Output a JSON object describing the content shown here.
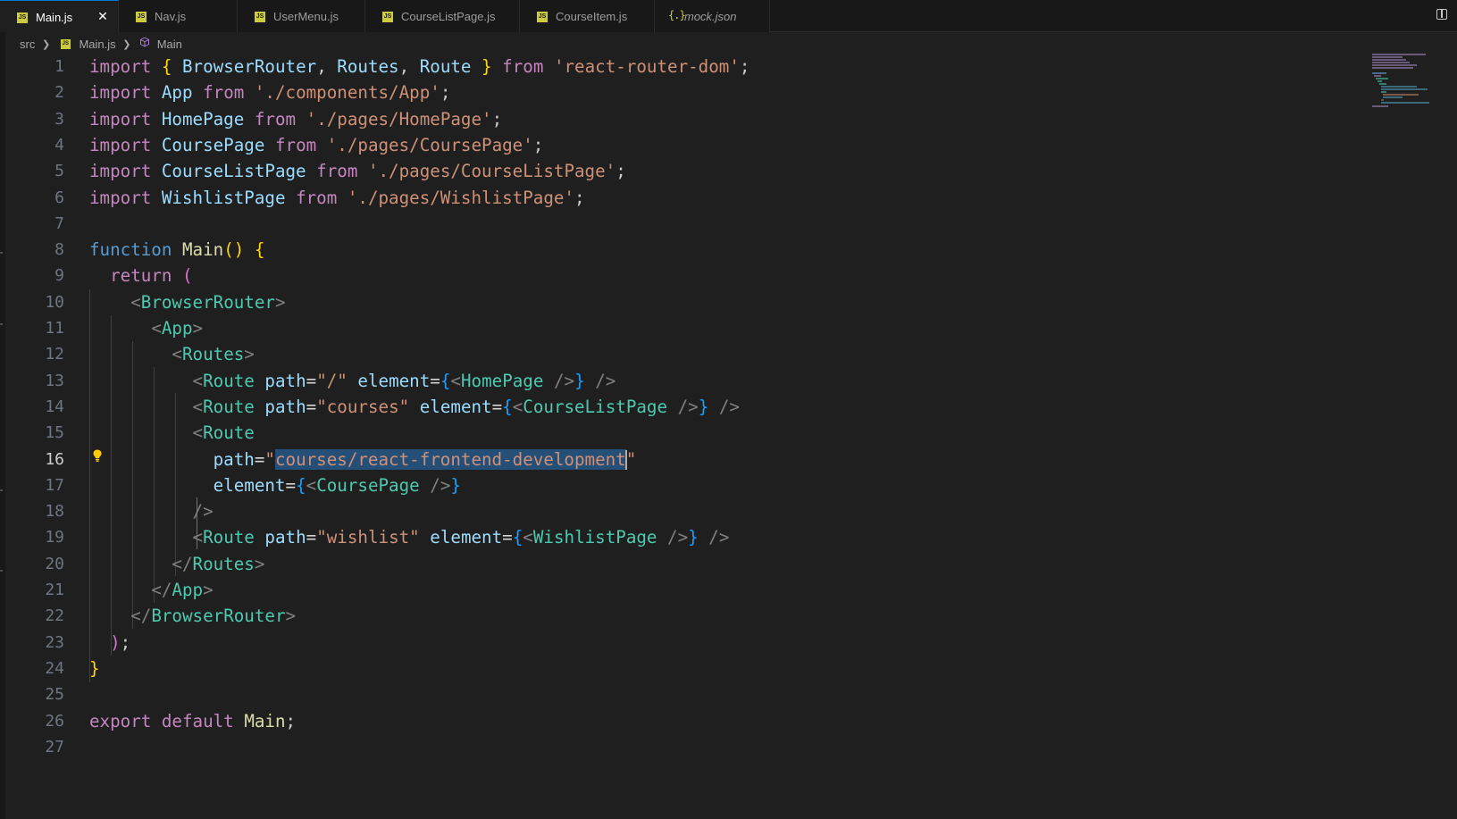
{
  "tabs": [
    {
      "label": "Main.js",
      "icon": "js-file-icon",
      "active": true
    },
    {
      "label": "Nav.js",
      "icon": "js-file-icon",
      "active": false
    },
    {
      "label": "UserMenu.js",
      "icon": "js-file-icon",
      "active": false
    },
    {
      "label": "CourseListPage.js",
      "icon": "js-file-icon",
      "active": false
    },
    {
      "label": "CourseItem.js",
      "icon": "js-file-icon",
      "active": false
    },
    {
      "label": "mock.json",
      "icon": "json-file-icon",
      "active": false
    }
  ],
  "breadcrumb": {
    "folder": "src",
    "file": "Main.js",
    "symbol": "Main"
  },
  "editor": {
    "active_line": 16,
    "lines": [
      {
        "n": "1",
        "text": "import { BrowserRouter, Routes, Route } from 'react-router-dom';"
      },
      {
        "n": "2",
        "text": "import App from './components/App';"
      },
      {
        "n": "3",
        "text": "import HomePage from './pages/HomePage';"
      },
      {
        "n": "4",
        "text": "import CoursePage from './pages/CoursePage';"
      },
      {
        "n": "5",
        "text": "import CourseListPage from './pages/CourseListPage';"
      },
      {
        "n": "6",
        "text": "import WishlistPage from './pages/WishlistPage';"
      },
      {
        "n": "7",
        "text": ""
      },
      {
        "n": "8",
        "text": "function Main() {"
      },
      {
        "n": "9",
        "text": "  return ("
      },
      {
        "n": "10",
        "text": "    <BrowserRouter>"
      },
      {
        "n": "11",
        "text": "      <App>"
      },
      {
        "n": "12",
        "text": "        <Routes>"
      },
      {
        "n": "13",
        "text": "          <Route path=\"/\" element={<HomePage />} />"
      },
      {
        "n": "14",
        "text": "          <Route path=\"courses\" element={<CourseListPage />} />"
      },
      {
        "n": "15",
        "text": "          <Route"
      },
      {
        "n": "16",
        "text": "            path=\"courses/react-frontend-development\""
      },
      {
        "n": "17",
        "text": "            element={<CoursePage />}"
      },
      {
        "n": "18",
        "text": "          />"
      },
      {
        "n": "19",
        "text": "          <Route path=\"wishlist\" element={<WishlistPage />} />"
      },
      {
        "n": "20",
        "text": "        </Routes>"
      },
      {
        "n": "21",
        "text": "      </App>"
      },
      {
        "n": "22",
        "text": "    </BrowserRouter>"
      },
      {
        "n": "23",
        "text": "  );"
      },
      {
        "n": "24",
        "text": "}"
      },
      {
        "n": "25",
        "text": ""
      },
      {
        "n": "26",
        "text": "export default Main;"
      },
      {
        "n": "27",
        "text": ""
      }
    ]
  },
  "colors": {
    "background": "#1f1f1f",
    "tabbar": "#181818",
    "accent": "#0078d4",
    "selection": "#264f78",
    "keyword_import": "#c586c0",
    "keyword_decl": "#569cd6",
    "string": "#ce9178",
    "function": "#dcdcaa",
    "component": "#4ec9b0",
    "attribute": "#9cdcfe"
  }
}
